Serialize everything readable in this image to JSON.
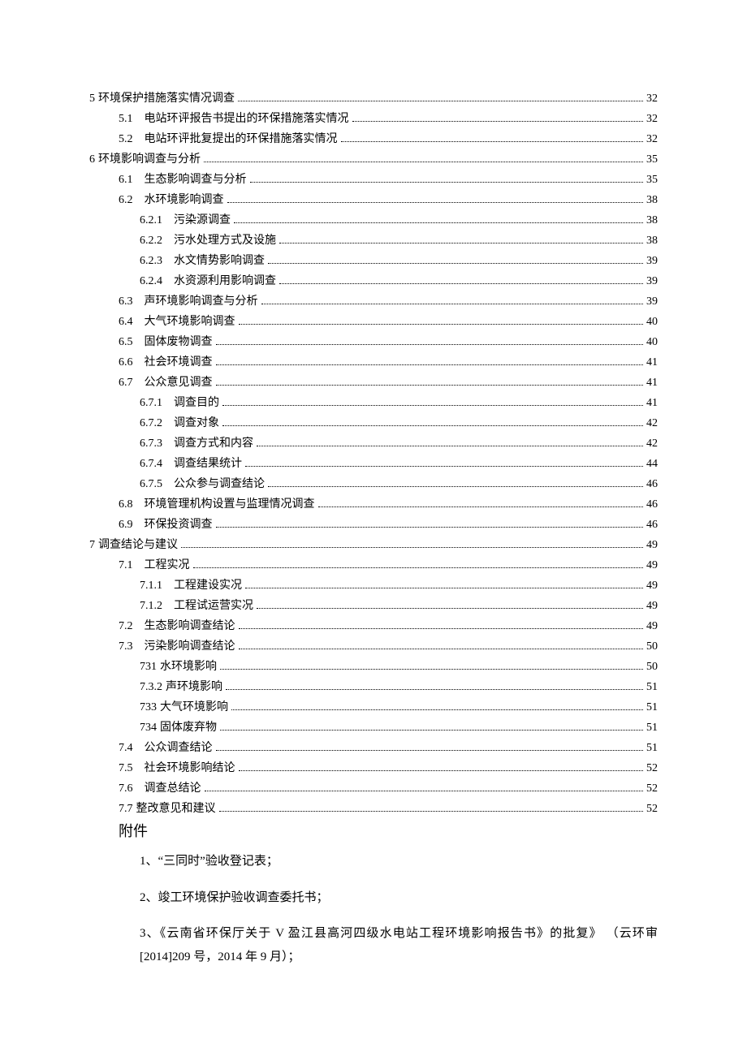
{
  "toc": [
    {
      "indent": 0,
      "num": "5",
      "label": "环境保护措施落实情况调查",
      "page": "32"
    },
    {
      "indent": 1,
      "num": "5.1",
      "label": "电站环评报告书提出的环保措施落实情况",
      "page": "32"
    },
    {
      "indent": 1,
      "num": "5.2",
      "label": "电站环评批复提出的环保措施落实情况",
      "page": "32"
    },
    {
      "indent": 0,
      "num": "6",
      "label": "环境影响调查与分析",
      "page": "35"
    },
    {
      "indent": 1,
      "num": "6.1",
      "label": "生态影响调查与分析",
      "page": "35"
    },
    {
      "indent": 1,
      "num": "6.2",
      "label": "水环境影响调查",
      "page": "38"
    },
    {
      "indent": 2,
      "num": "6.2.1",
      "label": "污染源调查",
      "page": "38"
    },
    {
      "indent": 2,
      "num": "6.2.2",
      "label": "污水处理方式及设施",
      "page": "38"
    },
    {
      "indent": 2,
      "num": "6.2.3",
      "label": "水文情势影响调查",
      "page": "39"
    },
    {
      "indent": 2,
      "num": "6.2.4",
      "label": "水资源利用影响调查",
      "page": "39"
    },
    {
      "indent": 1,
      "num": "6.3",
      "label": "声环境影响调查与分析",
      "page": "39"
    },
    {
      "indent": 1,
      "num": "6.4",
      "label": "大气环境影响调查",
      "page": "40"
    },
    {
      "indent": 1,
      "num": "6.5",
      "label": "固体废物调查",
      "page": "40"
    },
    {
      "indent": 1,
      "num": "6.6",
      "label": "社会环境调查",
      "page": "41"
    },
    {
      "indent": 1,
      "num": "6.7",
      "label": "公众意见调查",
      "page": "41"
    },
    {
      "indent": 2,
      "num": "6.7.1",
      "label": "调查目的",
      "page": "41"
    },
    {
      "indent": 2,
      "num": "6.7.2",
      "label": "调查对象",
      "page": "42"
    },
    {
      "indent": 2,
      "num": "6.7.3",
      "label": "调查方式和内容",
      "page": "42"
    },
    {
      "indent": 2,
      "num": "6.7.4",
      "label": "调查结果统计",
      "page": "44"
    },
    {
      "indent": 2,
      "num": "6.7.5",
      "label": "公众参与调查结论",
      "page": "46"
    },
    {
      "indent": 1,
      "num": "6.8",
      "label": "环境管理机构设置与监理情况调查",
      "page": "46"
    },
    {
      "indent": 1,
      "num": "6.9",
      "label": "环保投资调查",
      "page": "46"
    },
    {
      "indent": 0,
      "num": "7",
      "label": "调查结论与建议",
      "page": "49"
    },
    {
      "indent": 1,
      "num": "7.1",
      "label": "工程实况",
      "page": "49"
    },
    {
      "indent": 2,
      "num": "7.1.1",
      "label": "工程建设实况",
      "page": "49"
    },
    {
      "indent": 2,
      "num": "7.1.2",
      "label": "工程试运营实况",
      "page": "49"
    },
    {
      "indent": 1,
      "num": "7.2",
      "label": "生态影响调查结论",
      "page": "49"
    },
    {
      "indent": 1,
      "num": "7.3",
      "label": "污染影响调查结论",
      "page": "50"
    },
    {
      "indent": 2,
      "num": "731",
      "label": "水环境影响",
      "page": "50",
      "nospace": true
    },
    {
      "indent": 2,
      "num": "7.3.2",
      "label": "声环境影响",
      "page": "51",
      "nospace": true
    },
    {
      "indent": 2,
      "num": "733",
      "label": "大气环境影响",
      "page": "51",
      "nospace": true
    },
    {
      "indent": 2,
      "num": "734",
      "label": "固体废弃物",
      "page": "51",
      "nospace": true
    },
    {
      "indent": 1,
      "num": "7.4",
      "label": "公众调查结论",
      "page": "51"
    },
    {
      "indent": 1,
      "num": "7.5",
      "label": "社会环境影响结论",
      "page": "52"
    },
    {
      "indent": 1,
      "num": "7.6",
      "label": "调查总结论",
      "page": "52"
    },
    {
      "indent": 1,
      "num": "7.7",
      "label": "整改意见和建议",
      "page": "52",
      "nospace": true
    }
  ],
  "attachments": {
    "heading": "附件",
    "items": [
      "1、“三同时”验收登记表；",
      "2、竣工环境保护验收调查委托书；",
      "3、《云南省环保厅关于 V 盈江县高河四级水电站工程环境影响报告书》的批复》  （云环审[2014]209 号，2014 年 9 月）；"
    ]
  }
}
